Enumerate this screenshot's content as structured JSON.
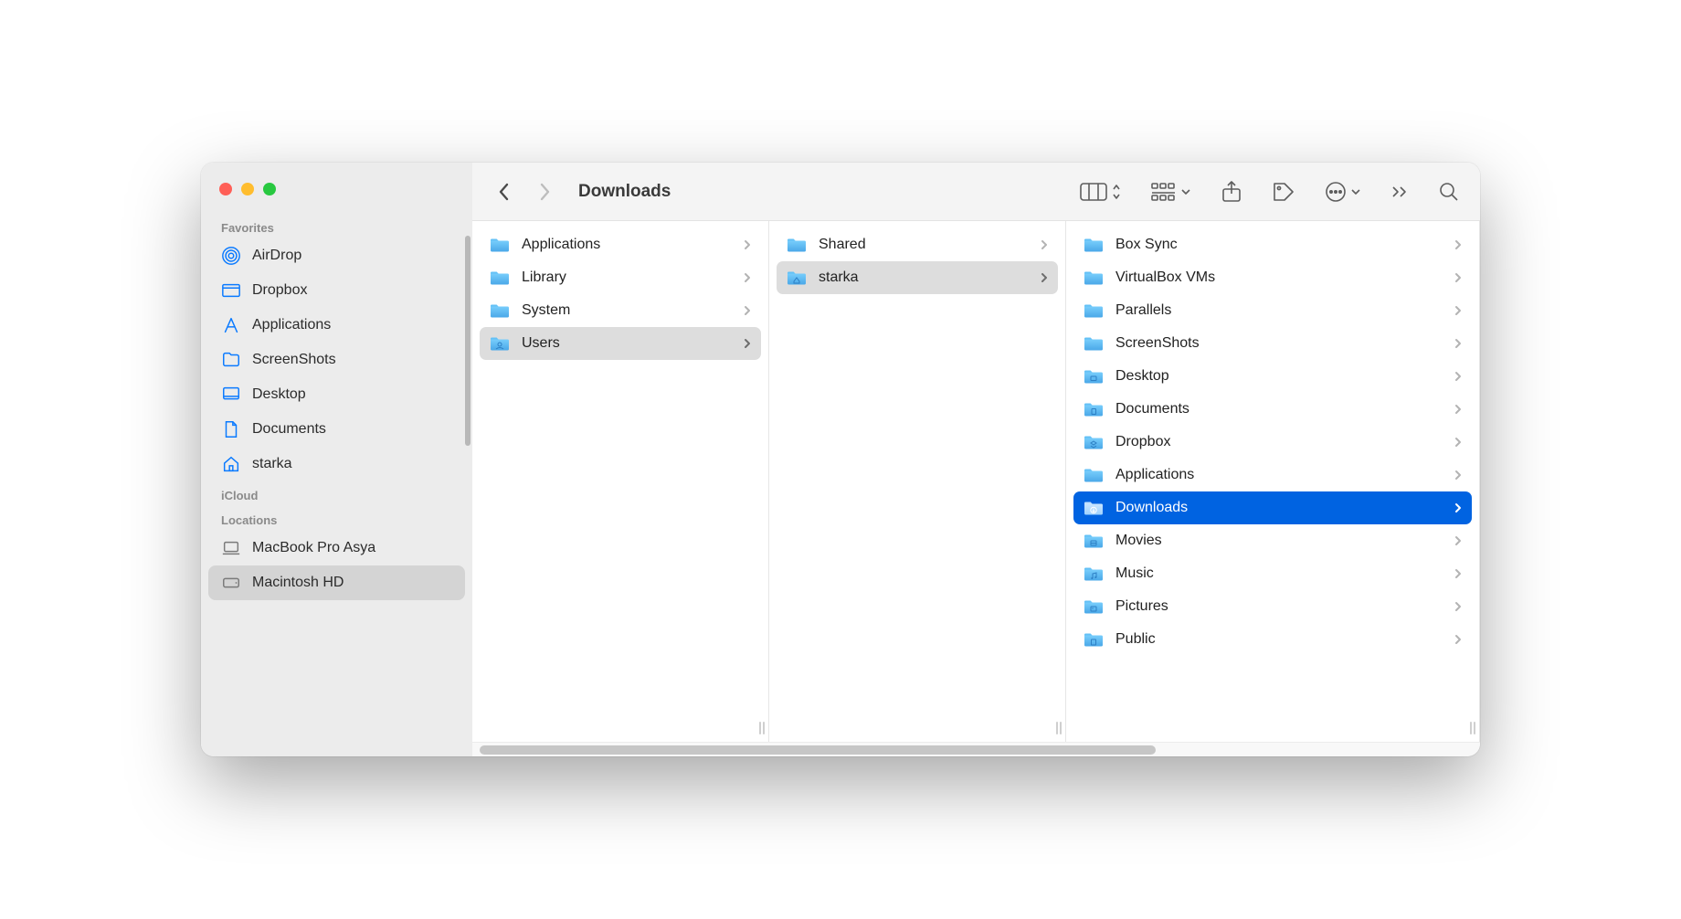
{
  "window_title": "Downloads",
  "sidebar": {
    "sections": [
      {
        "title": "Favorites",
        "items": [
          {
            "icon": "airdrop",
            "label": "AirDrop"
          },
          {
            "icon": "dropbox",
            "label": "Dropbox"
          },
          {
            "icon": "applications",
            "label": "Applications"
          },
          {
            "icon": "folder",
            "label": "ScreenShots"
          },
          {
            "icon": "desktop",
            "label": "Desktop"
          },
          {
            "icon": "document",
            "label": "Documents"
          },
          {
            "icon": "home",
            "label": "starka"
          }
        ]
      },
      {
        "title": "iCloud",
        "items": []
      },
      {
        "title": "Locations",
        "items": [
          {
            "icon": "laptop",
            "label": "MacBook Pro Asya"
          },
          {
            "icon": "hdd",
            "label": "Macintosh HD",
            "selected": true
          }
        ]
      }
    ]
  },
  "columns": [
    {
      "items": [
        {
          "icon": "folder",
          "label": "Applications"
        },
        {
          "icon": "folder",
          "label": "Library"
        },
        {
          "icon": "folder",
          "label": "System"
        },
        {
          "icon": "folder-users",
          "label": "Users",
          "selected": "gray"
        }
      ]
    },
    {
      "items": [
        {
          "icon": "folder",
          "label": "Shared"
        },
        {
          "icon": "folder-home",
          "label": "starka",
          "selected": "gray"
        }
      ]
    },
    {
      "items": [
        {
          "icon": "folder",
          "label": "Box Sync"
        },
        {
          "icon": "folder",
          "label": "VirtualBox VMs"
        },
        {
          "icon": "folder",
          "label": "Parallels"
        },
        {
          "icon": "folder",
          "label": "ScreenShots"
        },
        {
          "icon": "folder-desktop",
          "label": "Desktop"
        },
        {
          "icon": "folder-documents",
          "label": "Documents"
        },
        {
          "icon": "folder-dropbox",
          "label": "Dropbox"
        },
        {
          "icon": "folder",
          "label": "Applications"
        },
        {
          "icon": "folder-downloads",
          "label": "Downloads",
          "selected": "blue"
        },
        {
          "icon": "folder-movies",
          "label": "Movies"
        },
        {
          "icon": "folder-music",
          "label": "Music"
        },
        {
          "icon": "folder-pictures",
          "label": "Pictures"
        },
        {
          "icon": "folder-public",
          "label": "Public"
        }
      ]
    }
  ]
}
